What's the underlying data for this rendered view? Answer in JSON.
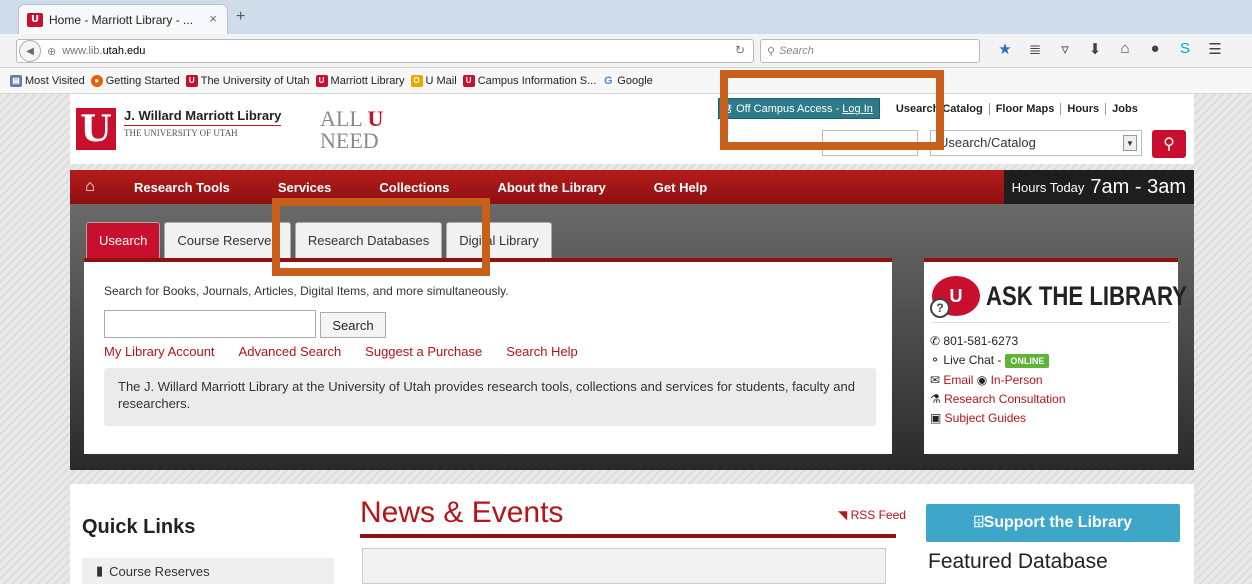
{
  "browser": {
    "tab_title": "Home - Marriott Library - ...",
    "tab_close": "×",
    "new_tab": "+",
    "url_prefix": "www.lib.",
    "url_domain": "utah.edu",
    "search_placeholder": "Search",
    "bookmarks": [
      "Most Visited",
      "Getting Started",
      "The University of Utah",
      "Marriott Library",
      "U Mail",
      "Campus Information S...",
      "Google"
    ]
  },
  "header": {
    "library_name": "J. Willard Marriott Library",
    "university": "THE UNIVERSITY OF UTAH",
    "tagline_1": "ALL",
    "tagline_u": "U",
    "tagline_2": "NEED",
    "off_campus": "Off Campus Access - ",
    "login": "Log In",
    "top_links": [
      "Usearch/Catalog",
      "Floor Maps",
      "Hours",
      "Jobs"
    ],
    "catalog_select": "Usearch/Catalog"
  },
  "nav": {
    "items": [
      "Research Tools",
      "Services",
      "Collections",
      "About the Library",
      "Get Help"
    ],
    "hours_label": "Hours Today",
    "hours_value": "7am - 3am"
  },
  "search": {
    "tabs": [
      "Usearch",
      "Course Reserves",
      "Research Databases",
      "Digital Library"
    ],
    "description": "Search for Books, Journals, Articles, Digital Items, and more simultaneously.",
    "button": "Search",
    "links": [
      "My Library Account",
      "Advanced Search",
      "Suggest a Purchase",
      "Search Help"
    ],
    "info": "The J. Willard Marriott Library at the University of Utah provides research tools, collections and services for students, faculty and researchers."
  },
  "ask": {
    "title": "ASK THE LIBRARY",
    "phone": "801-581-6273",
    "live_chat": "Live Chat -",
    "status": "ONLINE",
    "email": "Email",
    "in_person": "In-Person",
    "consultation": "Research Consultation",
    "guides": "Subject Guides"
  },
  "lower": {
    "quick_links_title": "Quick Links",
    "quick_links": [
      "Course Reserves"
    ],
    "news_title": "News & Events",
    "rss": "RSS Feed",
    "support": "Support the Library",
    "featured": "Featured Database"
  },
  "colors": {
    "utah_red": "#c8102e",
    "highlight": "#c8601b",
    "teal": "#2c7a8a",
    "support_blue": "#3ea6c9"
  }
}
